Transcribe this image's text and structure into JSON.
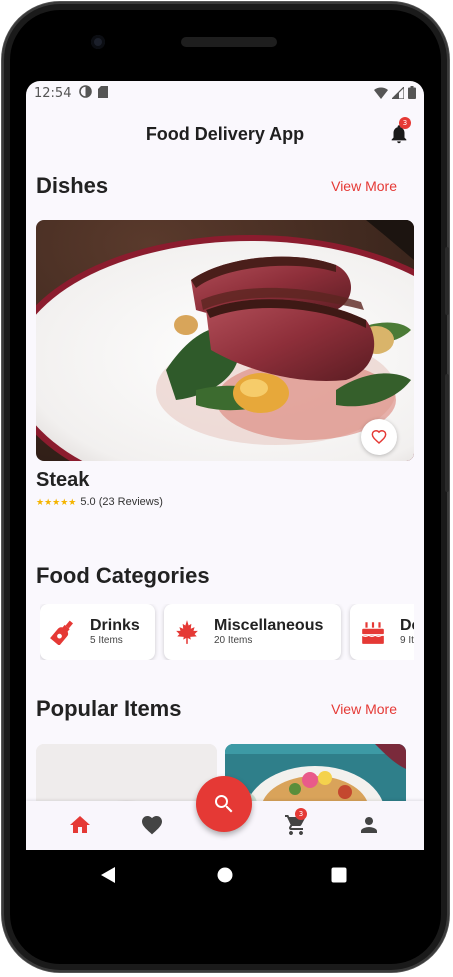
{
  "status_bar": {
    "time": "12:54"
  },
  "app_bar": {
    "title": "Food Delivery App",
    "notification_count": "3"
  },
  "dishes": {
    "heading": "Dishes",
    "view_more": "View More",
    "featured": {
      "name": "Steak",
      "stars": "★★★★★",
      "rating_text": "5.0 (23 Reviews)",
      "rating": 5.0
    }
  },
  "categories": {
    "heading": "Food Categories",
    "items": [
      {
        "name": "Drinks",
        "count": "5 Items",
        "icon": "bottle-icon"
      },
      {
        "name": "Miscellaneous",
        "count": "20 Items",
        "icon": "leaf-icon"
      },
      {
        "name": "De",
        "count": "9 It",
        "icon": "cake-icon"
      }
    ]
  },
  "popular": {
    "heading": "Popular Items",
    "view_more": "View More"
  },
  "bottom_nav": {
    "items": [
      "home-icon",
      "heart-icon",
      "search-icon",
      "cart-icon",
      "person-icon"
    ],
    "cart_count": "3"
  },
  "colors": {
    "accent": "#e53935",
    "background": "#faf8fd",
    "star": "#f4b400"
  }
}
